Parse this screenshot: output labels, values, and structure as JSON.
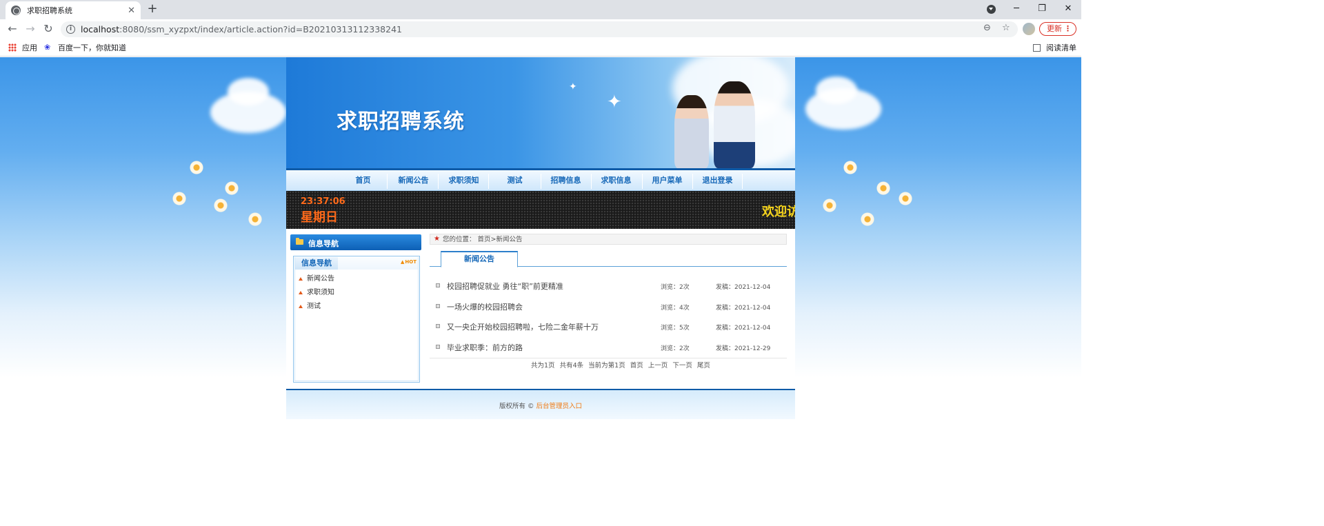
{
  "browser": {
    "tab_title": "求职招聘系统",
    "url_host": "localhost",
    "url_rest": ":8080/ssm_xyzpxt/index/article.action?id=B20210313112338241",
    "update_label": "更新",
    "bookmarks": [
      {
        "label": "应用",
        "icon": "apps-icon"
      },
      {
        "label": "百度一下，你就知道",
        "icon": "baidu-icon"
      }
    ],
    "reading_list": "阅读清单"
  },
  "site": {
    "title": "求职招聘系统",
    "menu": [
      "首页",
      "新闻公告",
      "求职须知",
      "测试",
      "招聘信息",
      "求职信息",
      "用户菜单",
      "退出登录"
    ],
    "clock": {
      "time": "23:37:06",
      "weekday": "星期日"
    },
    "marquee": "欢迎访"
  },
  "sidebar": {
    "header": "信息导航",
    "box_tab": "信息导航",
    "hot_badge": "HOT",
    "items": [
      "新闻公告",
      "求职须知",
      "测试"
    ]
  },
  "content": {
    "breadcrumb": "您的位置：  首页>新闻公告",
    "tab": "新闻公告",
    "news": [
      {
        "title": "校园招聘促就业 勇往“职”前更精准",
        "views": "浏览：2次",
        "date": "发稿：2021-12-04"
      },
      {
        "title": "一场火爆的校园招聘会",
        "views": "浏览：4次",
        "date": "发稿：2021-12-04"
      },
      {
        "title": "又一央企开始校园招聘啦，七险二金年薪十万",
        "views": "浏览：5次",
        "date": "发稿：2021-12-04"
      },
      {
        "title": "毕业求职季：前方的路",
        "views": "浏览：2次",
        "date": "发稿：2021-12-29"
      }
    ],
    "pager": {
      "total_pages": "共为1页",
      "total_items": "共有4条",
      "current": "当前为第1页",
      "first": "首页",
      "prev": "上一页",
      "next": "下一页",
      "last": "尾页"
    }
  },
  "footer": {
    "copyright": "版权所有 © ",
    "admin_link": "后台管理员入口"
  },
  "colors": {
    "brand_blue": "#1668b8",
    "led_orange": "#ff6a1a",
    "marquee_yellow": "#f7d51c",
    "link_orange": "#f07a12"
  }
}
